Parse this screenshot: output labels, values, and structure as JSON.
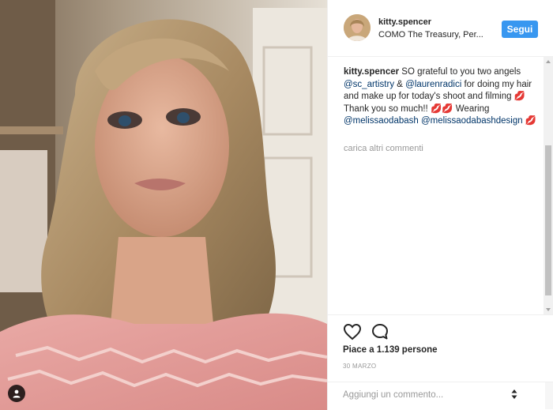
{
  "post": {
    "username": "kitty.spencer",
    "location": "COMO The Treasury, Per...",
    "follow_label": "Segui"
  },
  "caption": {
    "username": "kitty.spencer",
    "part1": " SO grateful to you two angels ",
    "mention1": "@sc_artistry",
    "part2": " & ",
    "mention2": "@laurenradici",
    "part3": " for doing my hair and make up for today's shoot and filming 💋 Thank you so much!! 💋💋 Wearing ",
    "mention3": "@melissaodabash",
    "part4": " ",
    "mention4": "@melissaodabashdesign",
    "part5": " 💋"
  },
  "load_more_label": "carica altri commenti",
  "likes_text": "Piace a 1.139 persone",
  "date_text": "30 MARZO",
  "comment_placeholder": "Aggiungi un commento...",
  "icons": {
    "like": "heart-icon",
    "comment": "comment-bubble-icon",
    "options": "more-options-icon",
    "user_tag": "user-tag-icon"
  },
  "colors": {
    "follow_button": "#3897f0",
    "mention": "#003569",
    "muted_text": "#999999"
  }
}
